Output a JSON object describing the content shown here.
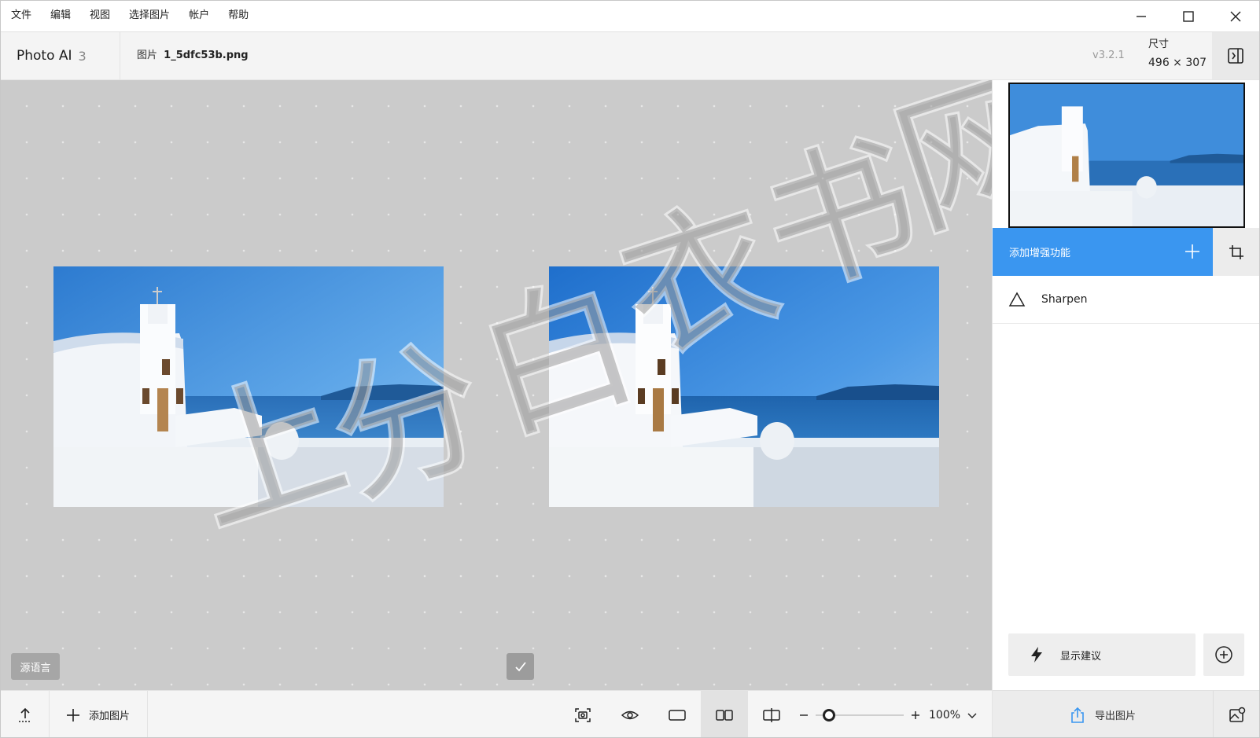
{
  "menubar": {
    "items": [
      "文件",
      "编辑",
      "视图",
      "选择图片",
      "帐户",
      "帮助"
    ]
  },
  "header": {
    "app_name": "Photo AI",
    "image_count": "3",
    "file_label": "图片",
    "file_name": "1_5dfc53b.png",
    "version": "v3.2.1",
    "dimension_title": "尺寸",
    "dimension_value": "496 × 307"
  },
  "canvas": {
    "source_button": "源语言",
    "watermark_chars": [
      "上",
      "分",
      "白",
      "衣",
      "书",
      "网"
    ]
  },
  "bottombar": {
    "add_image_label": "添加图片",
    "zoom_value": "100%",
    "zoom_level": 0.1
  },
  "rightpanel": {
    "add_enhancement_label": "添加增强功能",
    "enhancements": [
      {
        "name": "Sharpen"
      }
    ],
    "suggestions_label": "显示建议",
    "export_label": "导出图片"
  },
  "colors": {
    "accent": "#3a96f0",
    "canvas_bg": "#cbcbcb"
  }
}
